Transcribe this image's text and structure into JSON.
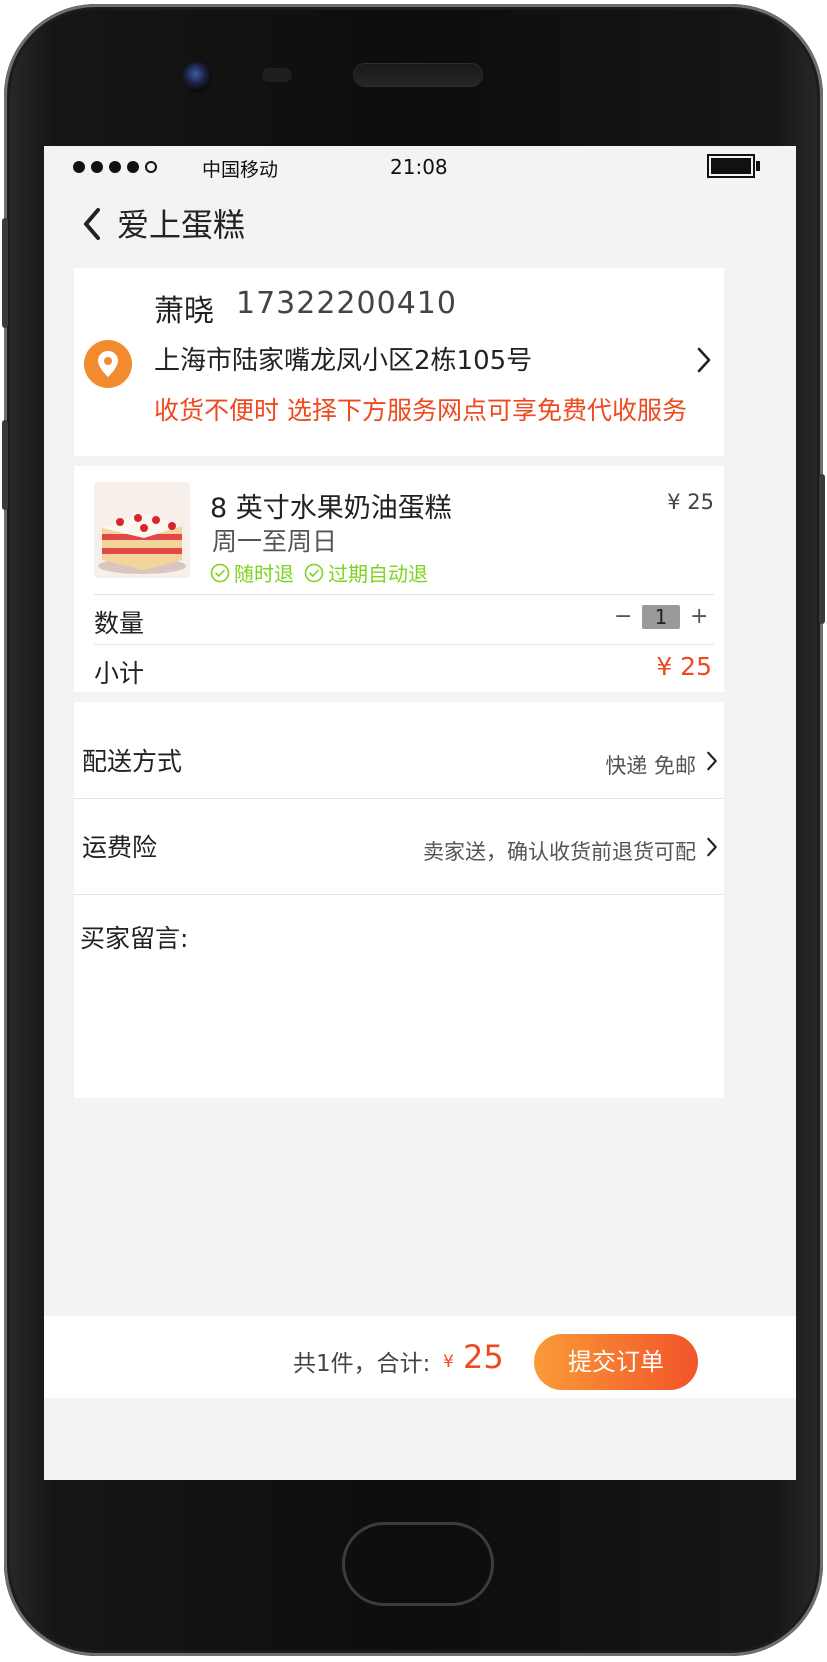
{
  "status_bar": {
    "carrier": "中国移动",
    "time": "21:08"
  },
  "nav": {
    "title": "爱上蛋糕"
  },
  "address": {
    "name": "萧晓",
    "phone": "17322200410",
    "address": "上海市陆家嘴龙凤小区2栋105号",
    "notice": "收货不便时 选择下方服务网点可享免费代收服务"
  },
  "item": {
    "title": "8 英寸水果奶油蛋糕",
    "subtitle": "周一至周日",
    "price": "¥ 25",
    "badges": [
      "随时退",
      "过期自动退"
    ],
    "quantity_label": "数量",
    "quantity_minus": "−",
    "quantity_value": "1",
    "quantity_plus": "+",
    "subtotal_label": "小计",
    "subtotal_value": "¥ 25"
  },
  "options": {
    "shipping_label": "配送方式",
    "shipping_value": "快递 免邮",
    "insurance_label": "运费险",
    "insurance_value": "卖家送，确认收货前退货可配",
    "message_label": "买家留言:"
  },
  "footer": {
    "summary": "共1件，合计:",
    "currency": "¥",
    "total": "25",
    "submit_label": "提交订单"
  },
  "colors": {
    "accent": "#ef4a1f",
    "badge_green": "#7ed321",
    "button_start": "#f99b37",
    "button_end": "#f2542a"
  }
}
